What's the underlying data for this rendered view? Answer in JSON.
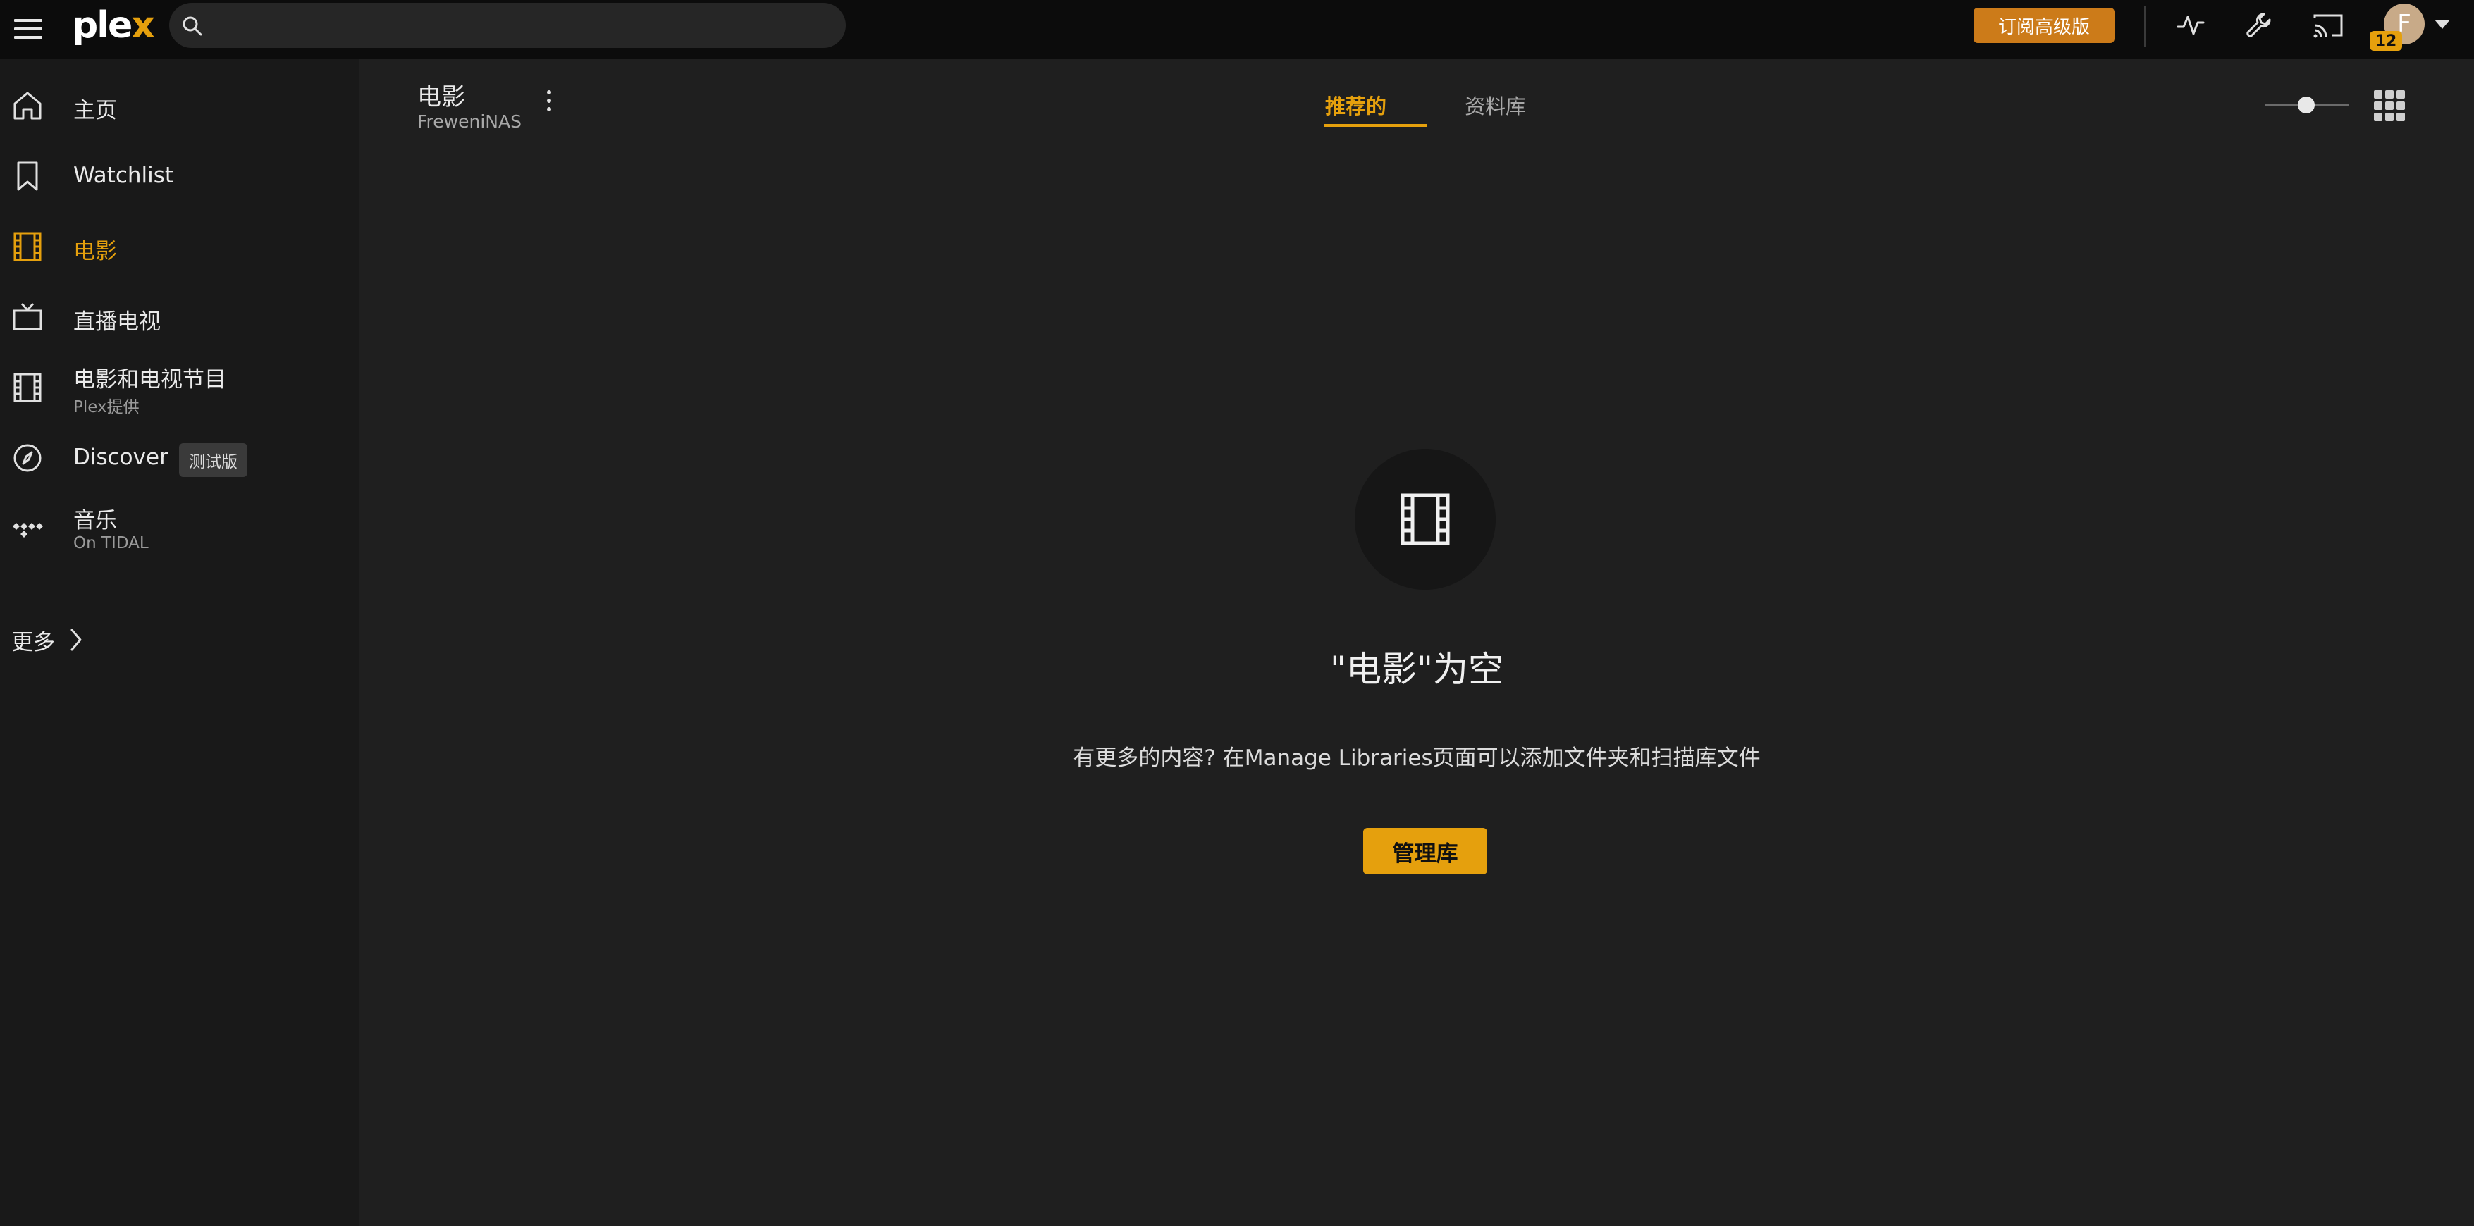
{
  "header": {
    "logo_main": "ple",
    "logo_x": "x",
    "search_placeholder": "",
    "upgrade_label": "订阅高级版",
    "avatar_initial": "F",
    "notification_count": "12"
  },
  "sidebar": {
    "items": [
      {
        "label": "主页",
        "icon": "home-icon"
      },
      {
        "label": "Watchlist",
        "icon": "bookmark-icon"
      },
      {
        "label": "电影",
        "icon": "film-icon",
        "active": true
      },
      {
        "label": "直播电视",
        "icon": "tv-icon"
      },
      {
        "label": "电影和电视节目",
        "sub": "Plex提供",
        "icon": "film-icon"
      },
      {
        "label": "Discover",
        "badge": "测试版",
        "icon": "compass-icon"
      },
      {
        "label": "音乐",
        "sub": "On TIDAL",
        "icon": "tidal-icon"
      }
    ],
    "more_label": "更多"
  },
  "library": {
    "title": "电影",
    "server": "FreweniNAS"
  },
  "tabs": [
    {
      "label": "推荐的",
      "active": true
    },
    {
      "label": "资料库",
      "active": false
    }
  ],
  "empty_state": {
    "title": "\"电影\"为空",
    "description": "有更多的内容? 在Manage Libraries页面可以添加文件夹和扫描库文件",
    "button_label": "管理库"
  },
  "colors": {
    "accent": "#e5a00d",
    "upgrade": "#cc7b19",
    "topbar": "#0c0c0c",
    "sidebar": "#191919",
    "main": "#1f1f1f"
  }
}
